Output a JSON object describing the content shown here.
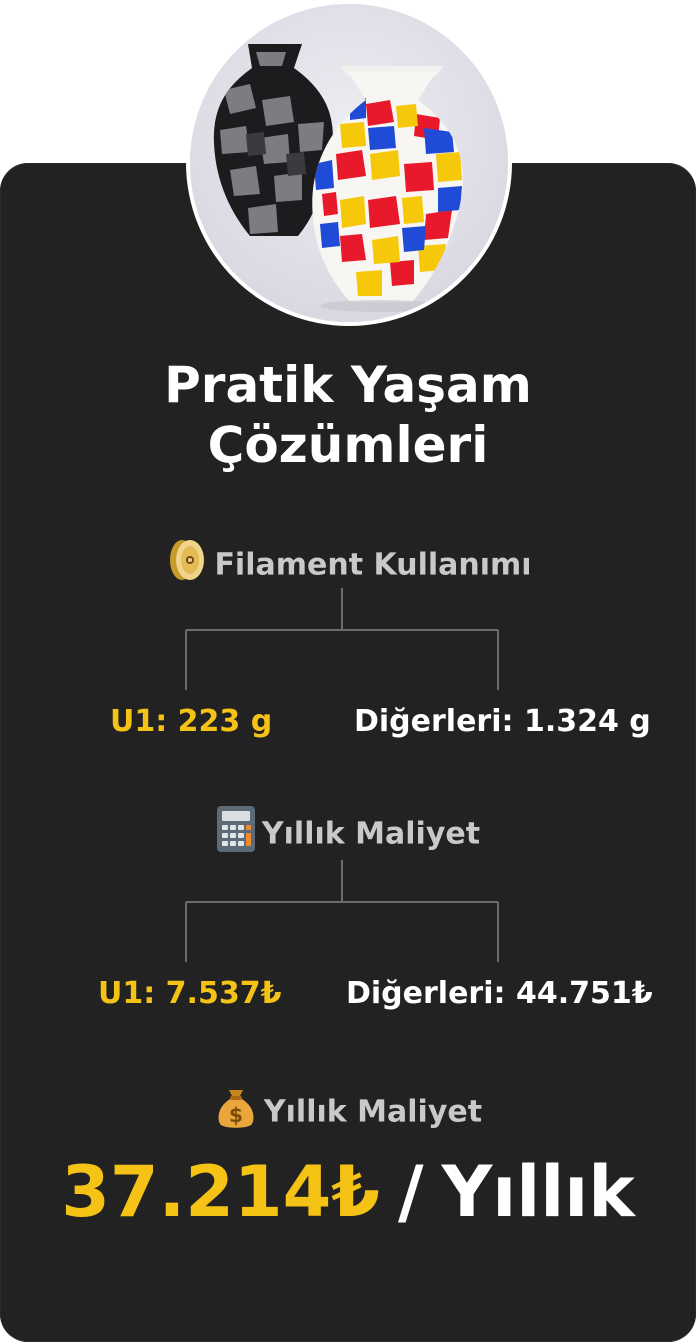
{
  "title_line1": "Pratik Yaşam",
  "title_line2": "Çözümleri",
  "filament": {
    "heading": "Filament Kullanımı",
    "icon": "filament-spool-icon",
    "left": "U1: 223 g",
    "right": "Diğerleri: 1.324 g"
  },
  "yearly_cost": {
    "heading": "Yıllık Maliyet",
    "icon": "calculator-icon",
    "left": "U1: 7.537₺",
    "right": "Diğerleri: 44.751₺"
  },
  "savings": {
    "heading": "Yıllık Maliyet",
    "icon": "money-bag-icon",
    "amount": "37.214₺",
    "separator": "/",
    "period": "Yıllık"
  },
  "colors": {
    "accent": "#f5c316",
    "card": "#222222",
    "text": "#ffffff",
    "muted": "#c9c9c9"
  }
}
